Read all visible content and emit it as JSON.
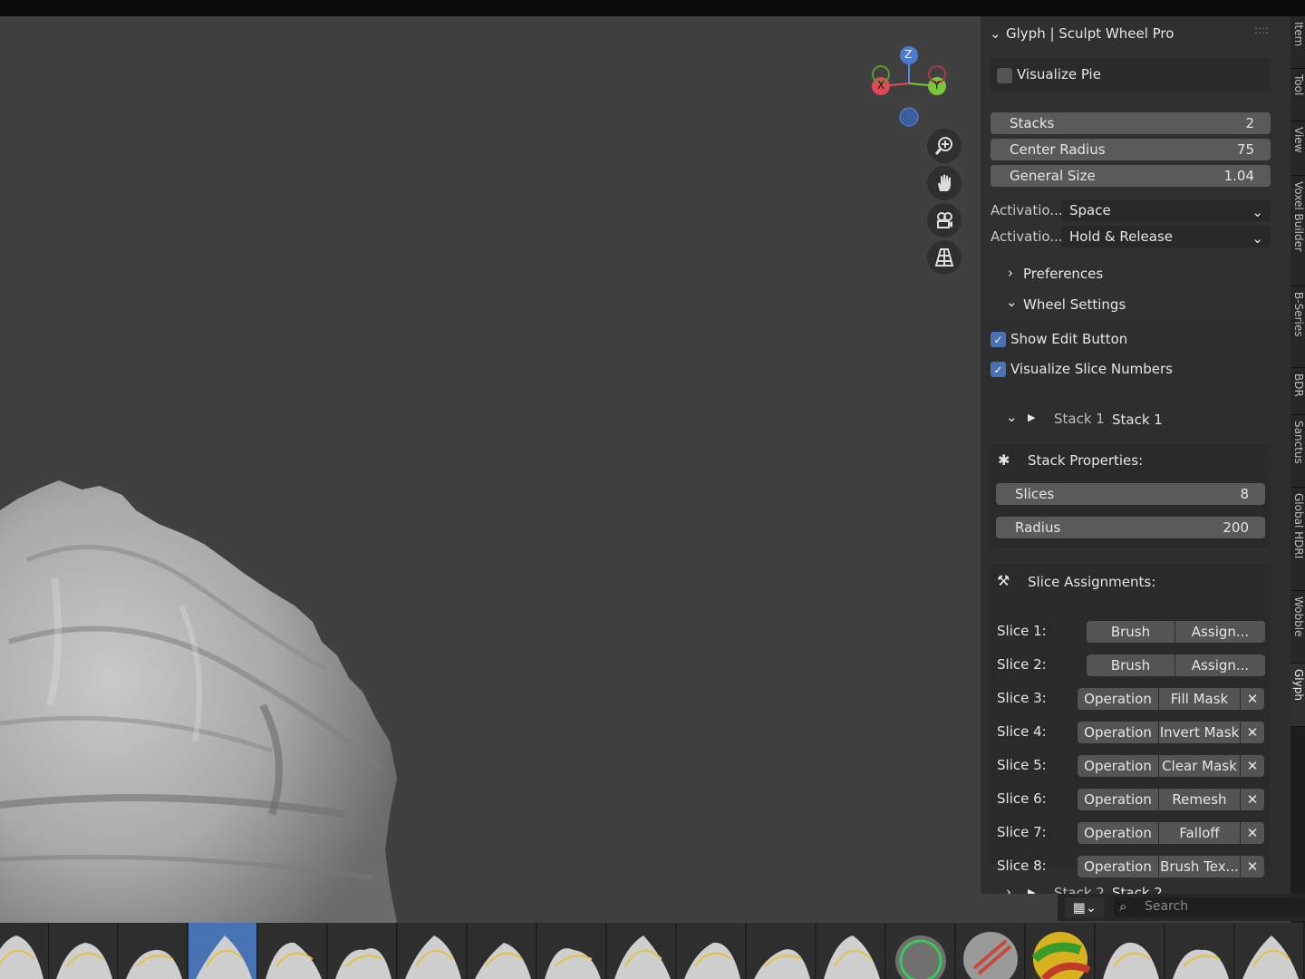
{
  "viewport": {
    "axis_labels": {
      "z": "Z",
      "x": "X",
      "y": "Y"
    },
    "nav_buttons": [
      "zoom-icon",
      "hand-icon",
      "camera-icon",
      "grid-icon"
    ]
  },
  "panel": {
    "title": "Glyph | Sculpt Wheel Pro",
    "visualize_pie": {
      "label": "Visualize Pie",
      "checked": false
    },
    "stacks": {
      "label": "Stacks",
      "value": "2"
    },
    "center_radius": {
      "label": "Center Radius",
      "value": "75"
    },
    "general_size": {
      "label": "General Size",
      "value": "1.04"
    },
    "activation1": {
      "label": "Activatio...",
      "value": "Space"
    },
    "activation2": {
      "label": "Activatio...",
      "value": "Hold & Release"
    },
    "preferences": "Preferences",
    "wheel_settings": "Wheel Settings",
    "show_edit_button": {
      "label": "Show Edit Button",
      "checked": true
    },
    "visualize_slice_numbers": {
      "label": "Visualize Slice Numbers",
      "checked": true
    },
    "stack1": {
      "name_label": "Stack 1",
      "name_value": "Stack 1"
    },
    "stack_properties": {
      "title": "Stack Properties:",
      "slices_label": "Slices",
      "slices_value": "8",
      "radius_label": "Radius",
      "radius_value": "200"
    },
    "slice_assignments": {
      "title": "Slice Assignments:",
      "slices": [
        {
          "label": "Slice 1:",
          "type": "Brush",
          "value": "Assign..."
        },
        {
          "label": "Slice 2:",
          "type": "Brush",
          "value": "Assign..."
        },
        {
          "label": "Slice 3:",
          "type": "Operation",
          "value": "Fill Mask"
        },
        {
          "label": "Slice 4:",
          "type": "Operation",
          "value": "Invert Mask"
        },
        {
          "label": "Slice 5:",
          "type": "Operation",
          "value": "Clear Mask"
        },
        {
          "label": "Slice 6:",
          "type": "Operation",
          "value": "Remesh"
        },
        {
          "label": "Slice 7:",
          "type": "Operation",
          "value": "Falloff"
        },
        {
          "label": "Slice 8:",
          "type": "Operation",
          "value": "Brush Tex..."
        }
      ]
    },
    "stack2_partial": {
      "name_label": "Stack 2",
      "name_value": "Stack 2"
    }
  },
  "side_tabs": [
    "Item",
    "Tool",
    "View",
    "Voxel Builder",
    "B-Series",
    "BDR",
    "Sanctus",
    "Global HDRI",
    "Wobble",
    "Glyph"
  ],
  "search": {
    "placeholder": "Search"
  },
  "colors": {
    "accent": "#4772b3",
    "panel": "#303030",
    "viewport": "#404040"
  }
}
